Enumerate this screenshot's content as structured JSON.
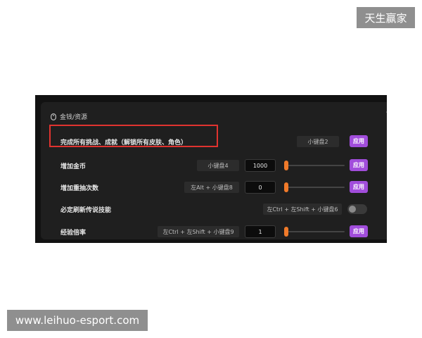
{
  "watermarks": {
    "top": "天生赢家",
    "bottom": "www.leihuo-esport.com"
  },
  "section": {
    "title": "金钱/资源",
    "icon": "mouse-icon"
  },
  "rows": [
    {
      "label": "完成所有挑战、成就（解锁所有皮肤、角色）",
      "hotkey": "小键盘2",
      "apply": "应用"
    },
    {
      "label": "增加金币",
      "hotkey": "小键盘4",
      "value": "1000",
      "slider_level": 0.0,
      "apply": "应用"
    },
    {
      "label": "增加重抽次数",
      "hotkey": "左Alt + 小键盘8",
      "value": "0",
      "slider_level": 0.0,
      "apply": "应用"
    },
    {
      "label": "必定刷新传说技能",
      "hotkey": "左Ctrl + 左Shift + 小键盘6",
      "toggle_on": false
    },
    {
      "label": "经验倍率",
      "hotkey": "左Ctrl + 左Shift + 小键盘9",
      "value": "1",
      "slider_level": 0.0,
      "apply": "应用"
    }
  ],
  "colors": {
    "accent": "#a14ddb",
    "slider": "#f07a2a",
    "highlight": "#e0332f"
  }
}
